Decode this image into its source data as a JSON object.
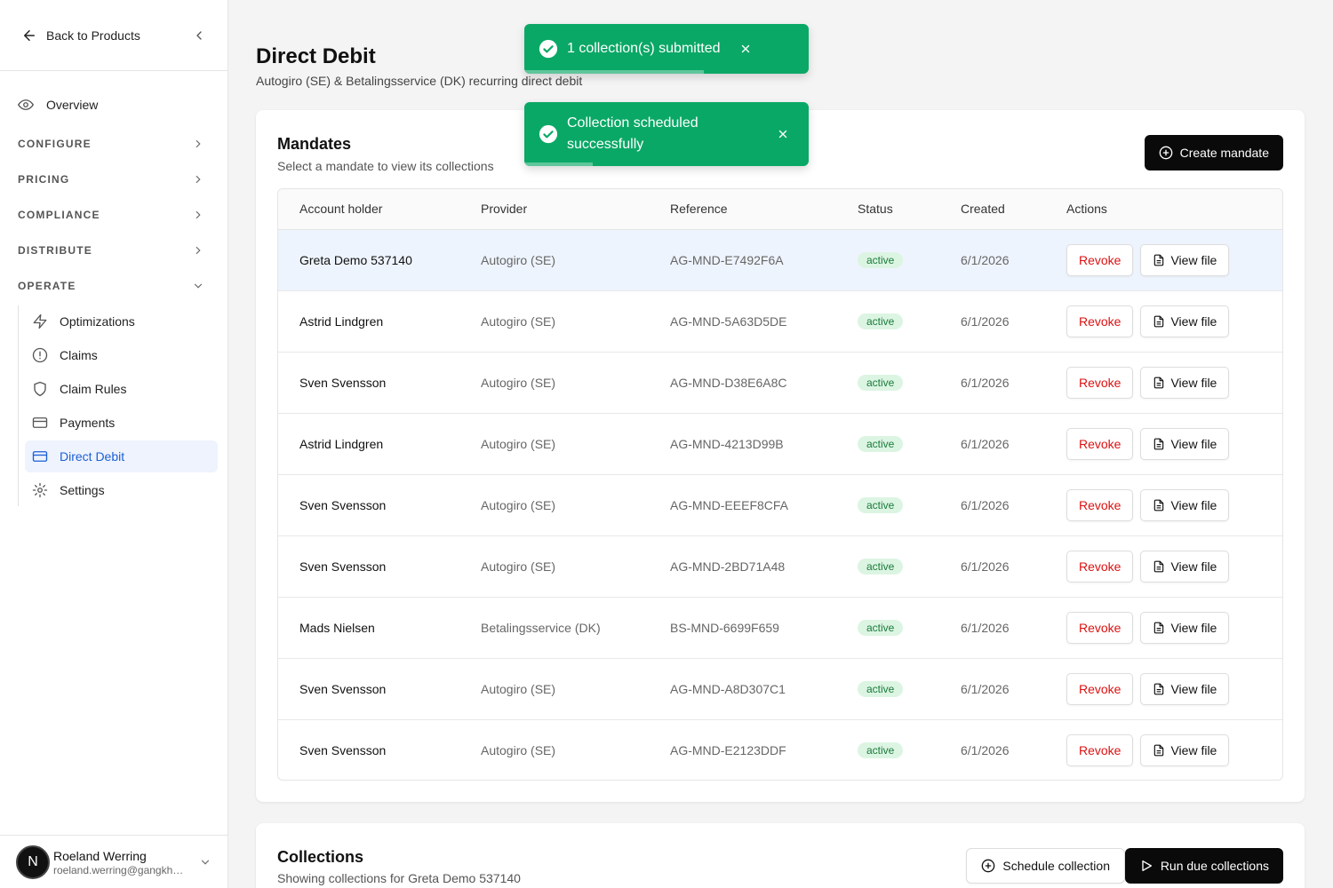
{
  "sidebar": {
    "back_label": "Back to Products",
    "overview": "Overview",
    "sections": {
      "configure": "CONFIGURE",
      "pricing": "PRICING",
      "compliance": "COMPLIANCE",
      "distribute": "DISTRIBUTE",
      "operate": "OPERATE"
    },
    "operate_items": {
      "optimizations": "Optimizations",
      "claims": "Claims",
      "claim_rules": "Claim Rules",
      "payments": "Payments",
      "direct_debit": "Direct Debit",
      "settings": "Settings"
    },
    "active_item": "Direct Debit"
  },
  "user": {
    "initial": "N",
    "name": "Roeland Werring",
    "email": "roeland.werring@gangkhar.io"
  },
  "page": {
    "title": "Direct Debit",
    "subtitle": "Autogiro (SE) & Betalingsservice (DK) recurring direct debit"
  },
  "mandates": {
    "title": "Mandates",
    "subtitle": "Select a mandate to view its collections",
    "create_label": "Create mandate",
    "columns": {
      "holder": "Account holder",
      "provider": "Provider",
      "reference": "Reference",
      "status": "Status",
      "created": "Created",
      "actions": "Actions"
    },
    "revoke_label": "Revoke",
    "view_label": "View file",
    "rows": [
      {
        "holder": "Greta Demo 537140",
        "provider": "Autogiro (SE)",
        "reference": "AG-MND-E7492F6A",
        "status": "active",
        "created": "6/1/2026"
      },
      {
        "holder": "Astrid Lindgren",
        "provider": "Autogiro (SE)",
        "reference": "AG-MND-5A63D5DE",
        "status": "active",
        "created": "6/1/2026"
      },
      {
        "holder": "Sven Svensson",
        "provider": "Autogiro (SE)",
        "reference": "AG-MND-D38E6A8C",
        "status": "active",
        "created": "6/1/2026"
      },
      {
        "holder": "Astrid Lindgren",
        "provider": "Autogiro (SE)",
        "reference": "AG-MND-4213D99B",
        "status": "active",
        "created": "6/1/2026"
      },
      {
        "holder": "Sven Svensson",
        "provider": "Autogiro (SE)",
        "reference": "AG-MND-EEEF8CFA",
        "status": "active",
        "created": "6/1/2026"
      },
      {
        "holder": "Sven Svensson",
        "provider": "Autogiro (SE)",
        "reference": "AG-MND-2BD71A48",
        "status": "active",
        "created": "6/1/2026"
      },
      {
        "holder": "Mads Nielsen",
        "provider": "Betalingsservice (DK)",
        "reference": "BS-MND-6699F659",
        "status": "active",
        "created": "6/1/2026"
      },
      {
        "holder": "Sven Svensson",
        "provider": "Autogiro (SE)",
        "reference": "AG-MND-A8D307C1",
        "status": "active",
        "created": "6/1/2026"
      },
      {
        "holder": "Sven Svensson",
        "provider": "Autogiro (SE)",
        "reference": "AG-MND-E2123DDF",
        "status": "active",
        "created": "6/1/2026"
      }
    ]
  },
  "collections": {
    "title": "Collections",
    "subtitle": "Showing collections for Greta Demo 537140",
    "schedule_label": "Schedule collection",
    "run_label": "Run due collections"
  },
  "toasts": [
    {
      "message": "1 collection(s) submitted",
      "progress": 0.63
    },
    {
      "message": "Collection scheduled successfully",
      "progress": 0.24
    }
  ],
  "colors": {
    "accent": "#1d5fd6",
    "toast": "#0aa866",
    "danger": "#dd1111",
    "badge_bg": "#dcf5e3"
  }
}
